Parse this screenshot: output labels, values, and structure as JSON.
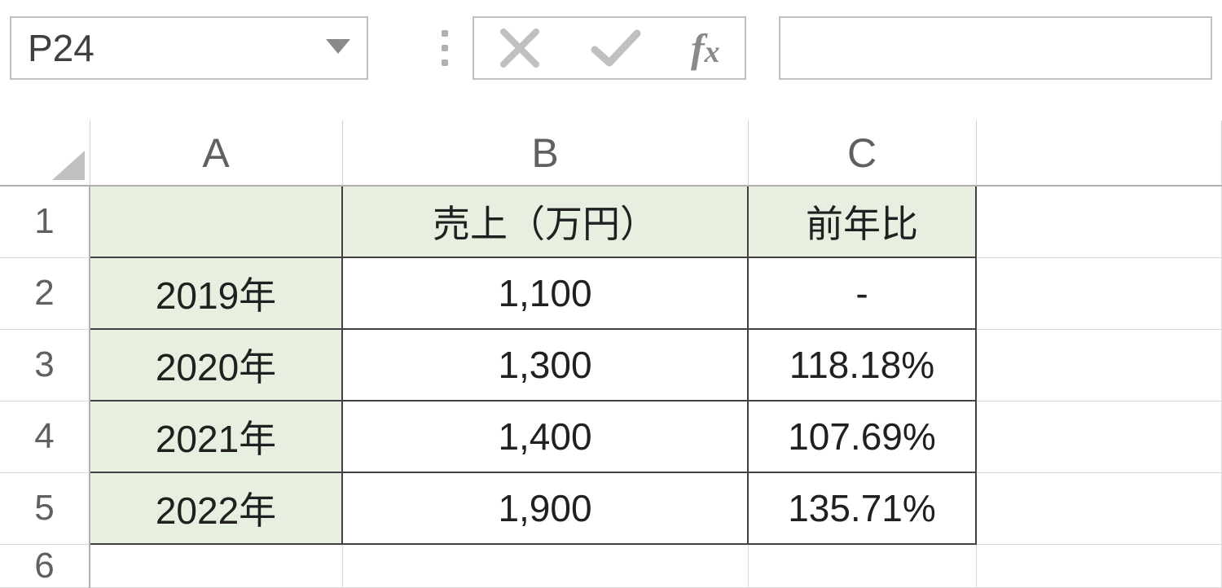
{
  "formula_bar": {
    "name_box": "P24",
    "formula": ""
  },
  "columns": [
    "A",
    "B",
    "C"
  ],
  "row_numbers": [
    "1",
    "2",
    "3",
    "4",
    "5",
    "6"
  ],
  "grid": {
    "header": {
      "A": "",
      "B": "売上（万円）",
      "C": "前年比"
    },
    "rows": [
      {
        "A": "2019年",
        "B": "1,100",
        "C": "-"
      },
      {
        "A": "2020年",
        "B": "1,300",
        "C": "118.18%"
      },
      {
        "A": "2021年",
        "B": "1,400",
        "C": "107.69%"
      },
      {
        "A": "2022年",
        "B": "1,900",
        "C": "135.71%"
      }
    ]
  }
}
